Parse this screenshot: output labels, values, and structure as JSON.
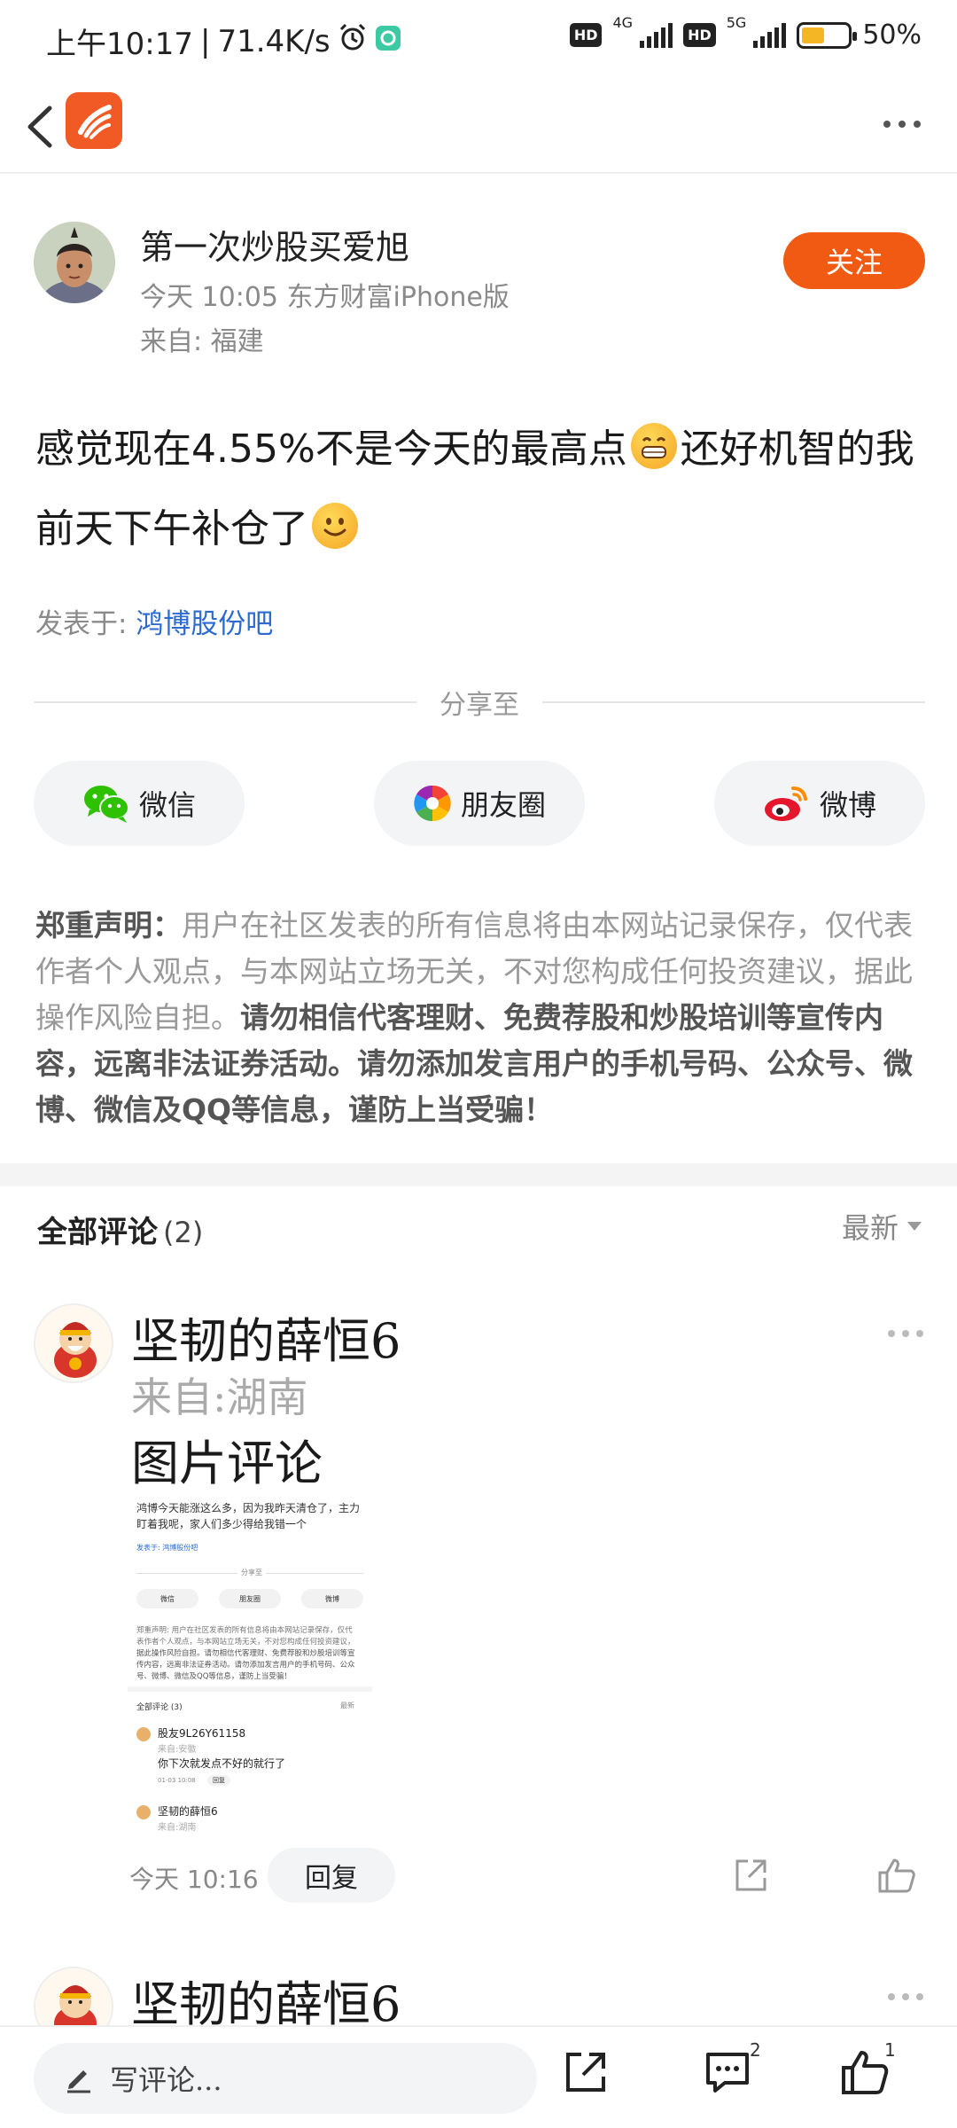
{
  "status": {
    "time": "上午10:17",
    "speed": "71.4K/s",
    "net1": "4G",
    "net2": "5G",
    "hd": "HD",
    "battery_text": "50%",
    "battery_level": 0.5
  },
  "nav": {
    "back_icon": "chevron-left-icon",
    "logo_icon": "eastmoney-logo",
    "more_icon": "more-horizontal-icon"
  },
  "post": {
    "author": "第一次炒股买爱旭",
    "meta": "今天 10:05 东方财富iPhone版",
    "location": "来自: 福建",
    "follow_label": "关注",
    "text_part1": "感觉现在4.55%不是今天的最高点",
    "text_part2": "还好机智的我前天下午补仓了",
    "posted_in_label": "发表于: ",
    "posted_in_bar": "鸿博股份吧"
  },
  "share": {
    "label": "分享至",
    "buttons": [
      {
        "label": "微信",
        "icon": "wechat-icon"
      },
      {
        "label": "朋友圈",
        "icon": "moments-icon"
      },
      {
        "label": "微博",
        "icon": "weibo-icon"
      }
    ]
  },
  "disclaimer": {
    "title": "郑重声明：",
    "normal": "用户在社区发表的所有信息将由本网站记录保存，仅代表作者个人观点，与本网站立场无关，不对您构成任何投资建议，据此操作风险自担。",
    "bold": "请勿相信代客理财、免费荐股和炒股培训等宣传内容，远离非法证券活动。请勿添加发言用户的手机号码、公众号、微博、微信及QQ等信息，谨防上当受骗！"
  },
  "comments": {
    "title": "全部评论",
    "count": "(2)",
    "sort": "最新",
    "items": [
      {
        "name": "坚韧的薛恒6",
        "location": "来自:湖南",
        "text": "图片评论",
        "time": "今天 10:16",
        "reply_label": "回复",
        "thumbnail": {
          "line1": "鸿博今天能涨这么多，因为我昨天清仓了，主力",
          "line2": "盯着我呢，家人们多少得给我错一个",
          "posted": "发表于: 鸿博股份吧",
          "share_label": "分享至",
          "btn1": "微信",
          "btn2": "朋友圈",
          "btn3": "微博",
          "discl1": "郑重声明: 用户在社区发表的所有信息将由本网站记录保存，仅代",
          "discl2": "表作者个人观点，与本网站立场无关，不对您构成任何投资建议，",
          "discl3": "据此操作风险自担。请勿相信代客理财、免费荐股和炒股培训等宣",
          "discl4": "传内容，远离非法证券活动。请勿添加发言用户的手机号码、公众",
          "discl5": "号、微博、微信及QQ等信息，谨防上当受骗！",
          "cm_title": "全部评论 (3)",
          "cm_sort": "最新",
          "cm1_name": "股友9L26Y61158",
          "cm1_loc": "来自:安徽",
          "cm1_text": "你下次就发点不好的就行了",
          "cm1_time": "01-03 10:08",
          "cm1_reply": "回复",
          "cm2_name": "坚韧的薛恒6",
          "cm2_loc": "来自:湖南"
        }
      },
      {
        "name": "坚韧的薛恒6"
      }
    ]
  },
  "bottom": {
    "write_placeholder": "写评论...",
    "comment_badge": "2",
    "like_badge": "1"
  },
  "colors": {
    "accent": "#f05a12",
    "link": "#2b6bd1",
    "battery": "#f5b626"
  }
}
